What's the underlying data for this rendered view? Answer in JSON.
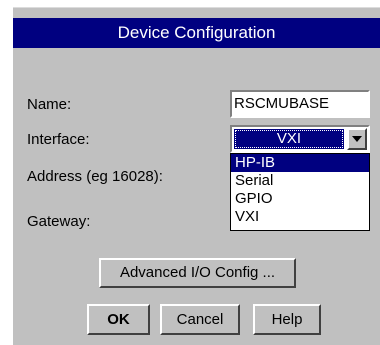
{
  "window": {
    "title": "Device Configuration"
  },
  "form": {
    "name_label": "Name:",
    "name_value": "RSCMUBASE",
    "interface_label": "Interface:",
    "interface_value": "VXI",
    "address_label": "Address (eg 16028):",
    "gateway_label": "Gateway:"
  },
  "interface_options": [
    "HP-IB",
    "Serial",
    "GPIO",
    "VXI"
  ],
  "buttons": {
    "advanced": "Advanced I/O Config ...",
    "ok": "OK",
    "cancel": "Cancel",
    "help": "Help"
  },
  "colors": {
    "dialog_bg": "#c0c0c0",
    "titlebar_bg": "#000080",
    "selection_bg": "#000080"
  }
}
